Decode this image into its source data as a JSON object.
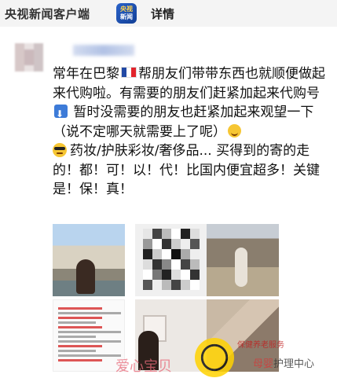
{
  "header": {
    "app_name": "央视新闻客户端",
    "logo_text_top": "央视",
    "logo_text_bottom": "新闻",
    "page_label": "详情"
  },
  "post": {
    "lines": [
      "常年在巴黎",
      "帮朋友们带带东西也就顺",
      "便做起来代购啦。有需要的朋友们赶紧",
      "加起来代购号",
      " 暂时没需要的朋友也",
      "赶紧加起来观望一下（说不定哪天就需",
      "要上了呢）",
      "药妆/护肤彩妆/奢侈品... 买得到的寄",
      "的走的！都！可！以！代！比国内便宜",
      "超多！关键是！保！真！"
    ],
    "icons": [
      "france-flag-icon",
      "down-arrow-icon",
      "smiling-face-icon",
      "sunglasses-face-icon"
    ]
  },
  "watermark": {
    "service": "保健养老服务",
    "left_text": "爱心宝贝",
    "right_text_a": "母婴",
    "right_text_b": "护理中心"
  },
  "colors": {
    "header_bg": "#f4f4f4",
    "logo_blue": "#2a62c9",
    "watermark_red": "#c02020"
  }
}
